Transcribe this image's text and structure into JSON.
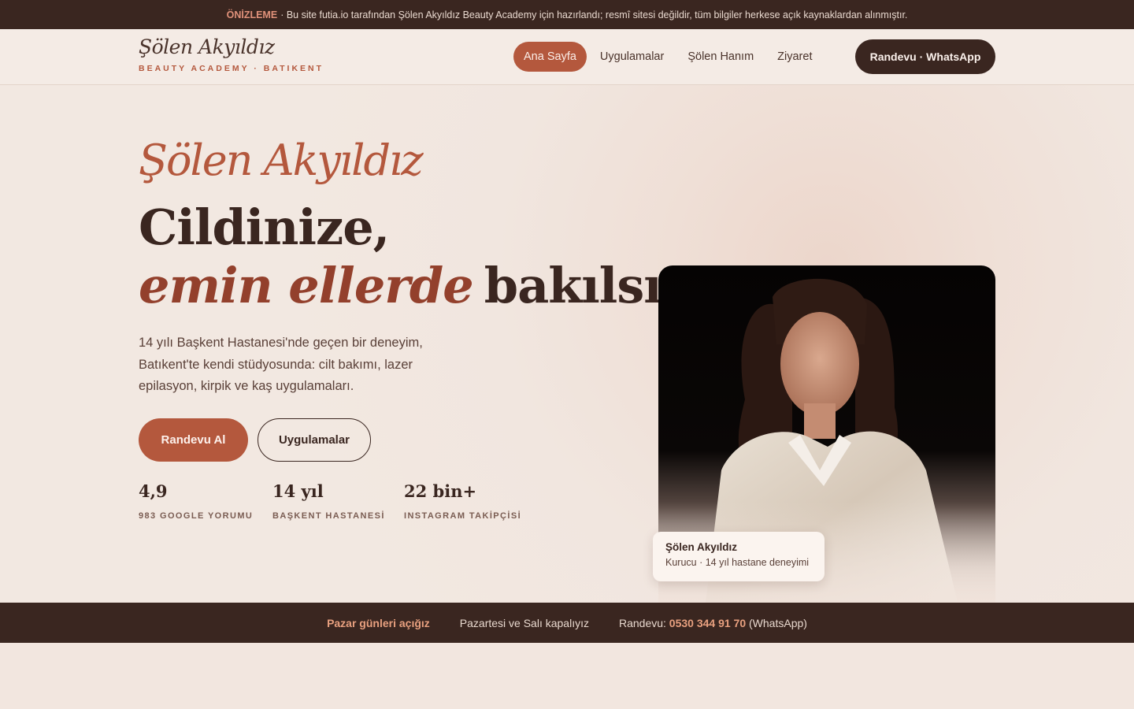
{
  "preview_bar": {
    "tag": "ÖNİZLEME",
    "text": "· Bu site futia.io tarafından Şölen Akyıldız Beauty Academy için hazırlandı; resmî sitesi değildir, tüm bilgiler herkese açık kaynaklardan alınmıştır."
  },
  "header": {
    "logo_script": "Şölen Akyıldız",
    "logo_sub": "BEAUTY ACADEMY · BATIKENT",
    "nav": [
      "Ana Sayfa",
      "Uygulamalar",
      "Şölen Hanım",
      "Ziyaret"
    ],
    "cta": "Randevu · WhatsApp"
  },
  "hero": {
    "script_name": "Şölen Akyıldız",
    "headline_1": "Cildinize,",
    "headline_em": "emin ellerde",
    "headline_2": "bakılsın.",
    "lead": "14 yılı Başkent Hastanesi'nde geçen bir deneyim, Batıkent'te kendi stüdyosunda: cilt bakımı, lazer epilasyon, kirpik ve kaş uygulamaları.",
    "btn_primary": "Randevu Al",
    "btn_secondary": "Uygulamalar",
    "stats": [
      {
        "num": "4,9",
        "label": "983 GOOGLE YORUMU"
      },
      {
        "num": "14 yıl",
        "label": "BAŞKENT HASTANESİ"
      },
      {
        "num": "22 bin+",
        "label": "INSTAGRAM TAKİPÇİSİ"
      }
    ],
    "caption": {
      "name": "Şölen Akyıldız",
      "sub": "Kurucu · 14 yıl hastane deneyimi"
    }
  },
  "infobar": {
    "open": "Pazar günleri açığız",
    "closed": "Pazartesi ve Salı kapalıyız",
    "appt_label": "Randevu:",
    "phone": "0530 344 91 70",
    "appt_suffix": "(WhatsApp)"
  },
  "colors": {
    "accent": "#b4583d",
    "dark": "#3a2620",
    "background": "#f2e6df"
  }
}
